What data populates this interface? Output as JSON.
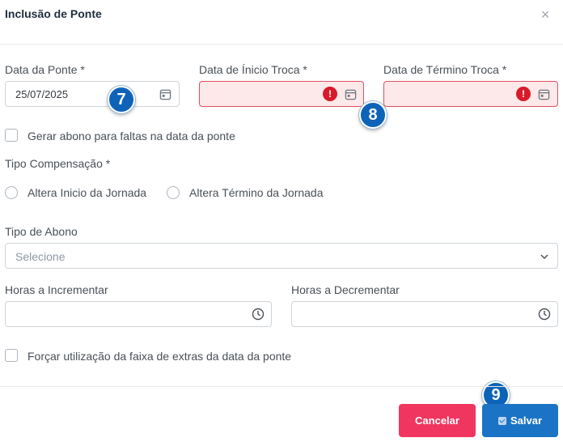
{
  "modal": {
    "title": "Inclusão de Ponte",
    "close_glyph": "×"
  },
  "form": {
    "data_ponte": {
      "label": "Data da Ponte *",
      "value": "25/07/2025"
    },
    "data_inicio_troca": {
      "label": "Data de Ínicio Troca *",
      "value": "",
      "state": "invalid"
    },
    "data_termino_troca": {
      "label": "Data de Término Troca *",
      "value": "",
      "state": "invalid"
    },
    "gerar_abono": {
      "label": "Gerar abono para faltas na data da ponte",
      "checked": false
    },
    "tipo_compensacao": {
      "label": "Tipo Compensação *",
      "options": [
        {
          "label": "Altera Inicio da Jornada",
          "checked": false
        },
        {
          "label": "Altera Término da Jornada",
          "checked": false
        }
      ]
    },
    "tipo_abono": {
      "label": "Tipo de Abono",
      "placeholder": "Selecione"
    },
    "horas_incrementar": {
      "label": "Horas a Incrementar",
      "value": ""
    },
    "horas_decrementar": {
      "label": "Horas a Decrementar",
      "value": ""
    },
    "forcar_extras": {
      "label": "Forçar utilização da faixa de extras da data da ponte",
      "checked": false
    }
  },
  "error_glyph": "!",
  "buttons": {
    "cancel": "Cancelar",
    "save": "Salvar"
  },
  "step_badges": {
    "seven": "7",
    "eight": "8",
    "nine": "9"
  },
  "colors": {
    "invalid_border": "#e04f5f",
    "invalid_bg": "#fde9ea",
    "cancel": "#f0365f",
    "save": "#1b73c5",
    "badge": "#0d63b8"
  }
}
